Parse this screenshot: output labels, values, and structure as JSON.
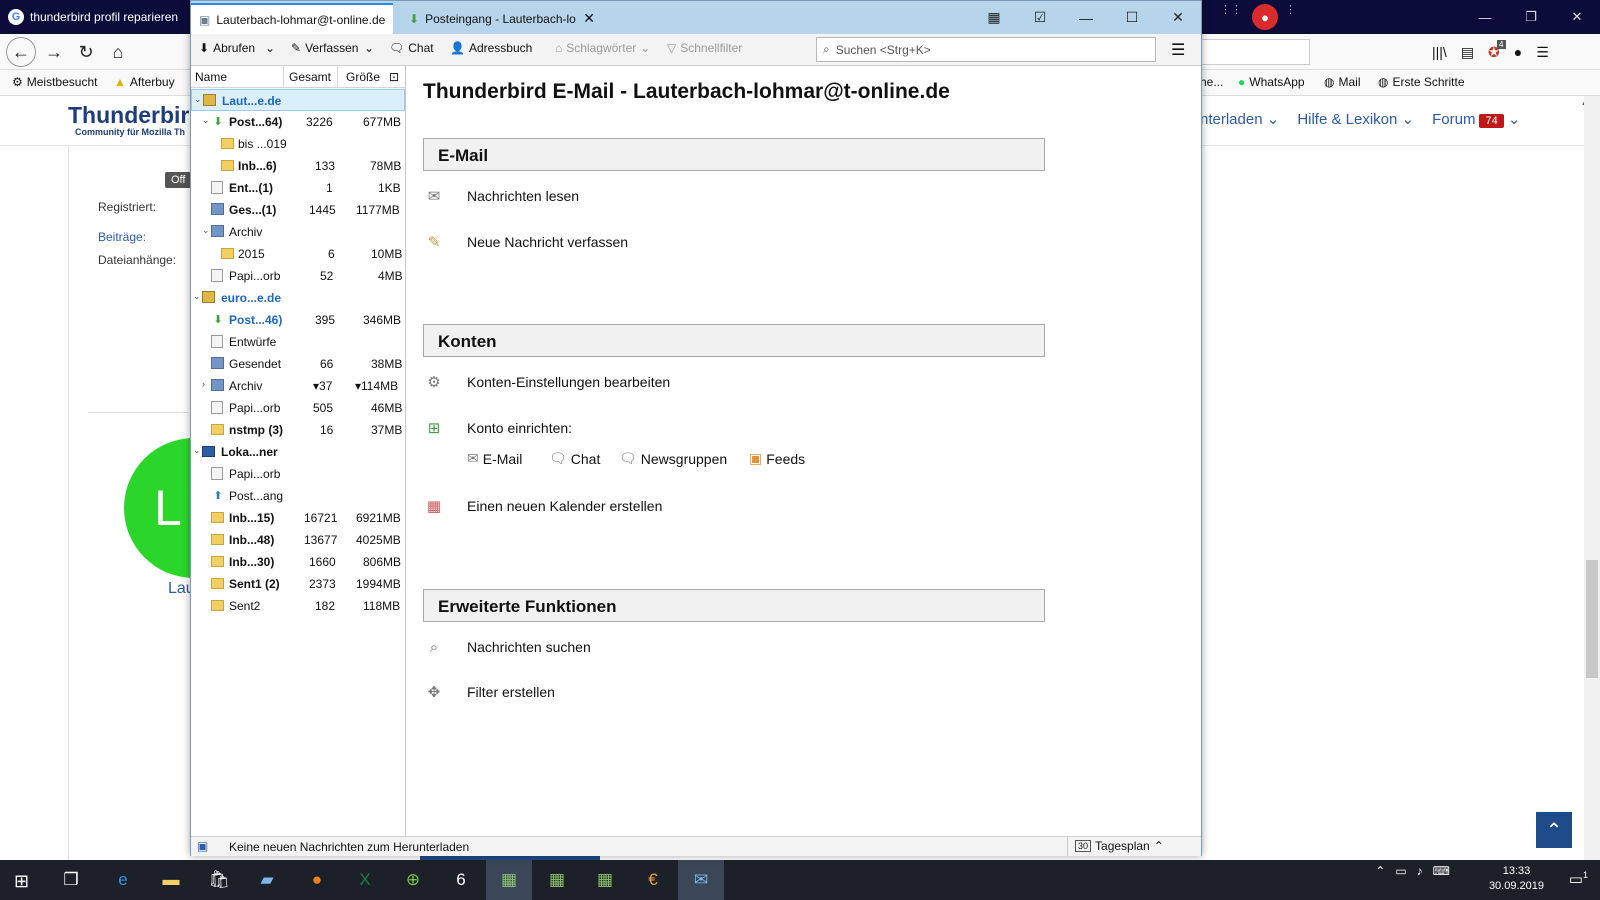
{
  "firefox": {
    "tab_title": "thunderbird profil reparieren",
    "bookmarks": [
      "Meistbesucht",
      "Afterbuy",
      "he...",
      "WhatsApp",
      "Mail",
      "Erste Schritte"
    ],
    "site_logo": "Thunderbir",
    "site_tagline": "Community für Mozilla Th",
    "nav": [
      "nterladen",
      "Hilfe & Lexikon",
      "Forum"
    ],
    "forum_badge": "74",
    "offline_badge": "Off",
    "profile_labels": [
      "Registriert:",
      "Beiträge:",
      "Dateianhänge:"
    ],
    "avatar_text": "L",
    "avatar_name": "Lau",
    "addon_badge": "4"
  },
  "thunderbird": {
    "tabs": [
      {
        "label": "Lauterbach-lohmar@t-online.de"
      },
      {
        "label": "Posteingang - Lauterbach-lo"
      }
    ],
    "toolbar": {
      "get_mail": "Abrufen",
      "write": "Verfassen",
      "chat": "Chat",
      "address_book": "Adressbuch",
      "tags": "Schlagwörter",
      "quick_filter": "Schnellfilter",
      "search_placeholder": "Suchen <Strg+K>"
    },
    "folder_pane": {
      "headers": {
        "name": "Name",
        "total": "Gesamt",
        "size": "Größe"
      },
      "rows": [
        {
          "name": "Laut...e.de",
          "total": "",
          "size": ""
        },
        {
          "name": "Post...64)",
          "total": "3226",
          "size": "677MB"
        },
        {
          "name": "bis ...019",
          "total": "",
          "size": ""
        },
        {
          "name": "Inb...6)",
          "total": "133",
          "size": "78MB"
        },
        {
          "name": "Ent...(1)",
          "total": "1",
          "size": "1KB"
        },
        {
          "name": "Ges...(1)",
          "total": "1445",
          "size": "1177MB"
        },
        {
          "name": "Archiv",
          "total": "",
          "size": ""
        },
        {
          "name": "2015",
          "total": "6",
          "size": "10MB"
        },
        {
          "name": "Papi...orb",
          "total": "52",
          "size": "4MB"
        },
        {
          "name": "euro...e.de",
          "total": "",
          "size": ""
        },
        {
          "name": "Post...46)",
          "total": "395",
          "size": "346MB"
        },
        {
          "name": "Entwürfe",
          "total": "",
          "size": ""
        },
        {
          "name": "Gesendet",
          "total": "66",
          "size": "38MB"
        },
        {
          "name": "Archiv",
          "total": "▾37",
          "size": "▾114MB"
        },
        {
          "name": "Papi...orb",
          "total": "505",
          "size": "46MB"
        },
        {
          "name": "nstmp (3)",
          "total": "16",
          "size": "37MB"
        },
        {
          "name": "Loka...ner",
          "total": "",
          "size": ""
        },
        {
          "name": "Papi...orb",
          "total": "",
          "size": ""
        },
        {
          "name": "Post...ang",
          "total": "",
          "size": ""
        },
        {
          "name": "Inb...15)",
          "total": "16721",
          "size": "6921MB"
        },
        {
          "name": "Inb...48)",
          "total": "13677",
          "size": "4025MB"
        },
        {
          "name": "Inb...30)",
          "total": "1660",
          "size": "806MB"
        },
        {
          "name": "Sent1 (2)",
          "total": "2373",
          "size": "1994MB"
        },
        {
          "name": "Sent2",
          "total": "182",
          "size": "118MB"
        }
      ]
    },
    "main": {
      "title": "Thunderbird E-Mail - Lauterbach-lohmar@t-online.de",
      "sections": {
        "email": "E-Mail",
        "accounts": "Konten",
        "advanced": "Erweiterte Funktionen"
      },
      "items": {
        "read": "Nachrichten lesen",
        "compose": "Neue Nachricht verfassen",
        "account_settings": "Konten-Einstellungen bearbeiten",
        "setup_account": "Konto einrichten:",
        "setup_email": "E-Mail",
        "setup_chat": "Chat",
        "setup_news": "Newsgruppen",
        "setup_feeds": "Feeds",
        "new_calendar": "Einen neuen Kalender erstellen",
        "search_messages": "Nachrichten suchen",
        "create_filter": "Filter erstellen"
      }
    },
    "status": {
      "message": "Keine neuen Nachrichten zum Herunterladen",
      "today_pane": "Tagesplan",
      "calendar_day": "30"
    }
  },
  "taskbar": {
    "time": "13:33",
    "date": "30.09.2019",
    "notification_count": "1"
  }
}
